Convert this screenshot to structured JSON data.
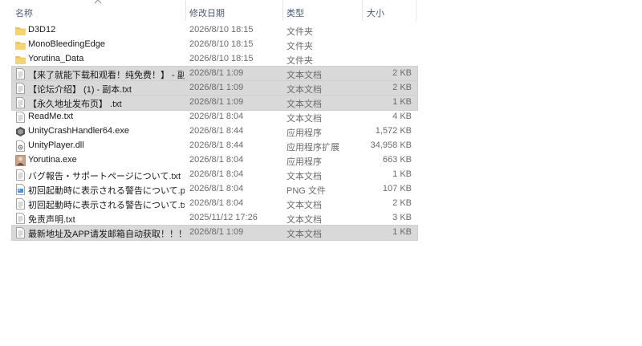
{
  "columns": {
    "name": "名称",
    "date": "修改日期",
    "type": "类型",
    "size": "大小"
  },
  "files": [
    {
      "name": "D3D12",
      "date": "2026/8/10 18:15",
      "type": "文件夹",
      "size": "",
      "icon": "folder-icon",
      "selected": false
    },
    {
      "name": "MonoBleedingEdge",
      "date": "2026/8/10 18:15",
      "type": "文件夹",
      "size": "",
      "icon": "folder-icon",
      "selected": false
    },
    {
      "name": "Yorutina_Data",
      "date": "2026/8/10 18:15",
      "type": "文件夹",
      "size": "",
      "icon": "folder-icon",
      "selected": false
    },
    {
      "name": "【来了就能下载和观看！纯免费！】 - 副...",
      "date": "2026/8/1 1:09",
      "type": "文本文档",
      "size": "2 KB",
      "icon": "text-file-icon",
      "selected": true
    },
    {
      "name": "【论坛介绍】 (1) - 副本.txt",
      "date": "2026/8/1 1:09",
      "type": "文本文档",
      "size": "2 KB",
      "icon": "text-file-icon",
      "selected": true
    },
    {
      "name": "【永久地址发布页】 .txt",
      "date": "2026/8/1 1:09",
      "type": "文本文档",
      "size": "1 KB",
      "icon": "text-file-icon",
      "selected": true
    },
    {
      "name": "ReadMe.txt",
      "date": "2026/8/1 8:04",
      "type": "文本文档",
      "size": "4 KB",
      "icon": "text-file-icon",
      "selected": false
    },
    {
      "name": "UnityCrashHandler64.exe",
      "date": "2026/8/1 8:44",
      "type": "应用程序",
      "size": "1,572 KB",
      "icon": "unity-app-icon",
      "selected": false
    },
    {
      "name": "UnityPlayer.dll",
      "date": "2026/8/1 8:44",
      "type": "应用程序扩展",
      "size": "34,958 KB",
      "icon": "dll-file-icon",
      "selected": false
    },
    {
      "name": "Yorutina.exe",
      "date": "2026/8/1 8:04",
      "type": "应用程序",
      "size": "663 KB",
      "icon": "game-app-icon",
      "selected": false
    },
    {
      "name": "バグ報告・サポートページについて.txt",
      "date": "2026/8/1 8:04",
      "type": "文本文档",
      "size": "1 KB",
      "icon": "text-file-icon",
      "selected": false
    },
    {
      "name": "初回起動時に表示される警告について.p...",
      "date": "2026/8/1 8:04",
      "type": "PNG 文件",
      "size": "107 KB",
      "icon": "image-file-icon",
      "selected": false
    },
    {
      "name": "初回起動時に表示される警告について.txt",
      "date": "2026/8/1 8:04",
      "type": "文本文档",
      "size": "2 KB",
      "icon": "text-file-icon",
      "selected": false
    },
    {
      "name": "免责声明.txt",
      "date": "2025/11/12 17:26",
      "type": "文本文档",
      "size": "3 KB",
      "icon": "text-file-icon",
      "selected": false
    },
    {
      "name": "最新地址及APP请发邮箱自动获取！！！...",
      "date": "2026/8/1 1:09",
      "type": "文本文档",
      "size": "1 KB",
      "icon": "text-file-icon",
      "selected": true
    }
  ]
}
